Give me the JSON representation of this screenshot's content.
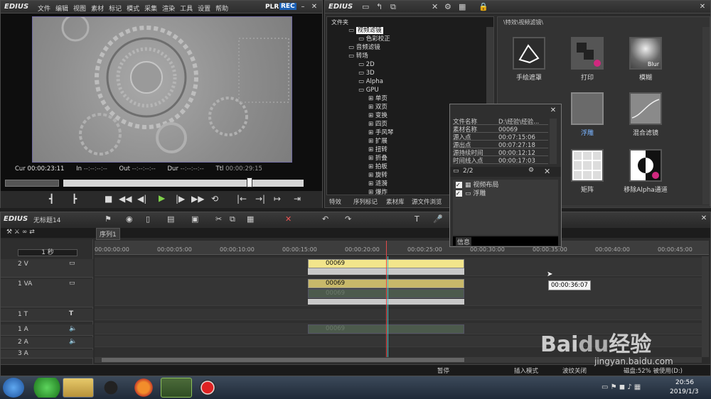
{
  "player": {
    "logo": "EDIUS",
    "menu": [
      "文件",
      "编辑",
      "视图",
      "素材",
      "标记",
      "模式",
      "采集",
      "渲染",
      "工具",
      "设置",
      "帮助"
    ],
    "plr": "PLR",
    "rec": "REC",
    "cur_label": "Cur",
    "cur": "00:00:23:11",
    "in_label": "In",
    "in": "--:--:--:--",
    "out_label": "Out",
    "out": "--:--:--:--",
    "dur_label": "Dur",
    "dur": "--:--:--:--",
    "ttl_label": "Ttl",
    "ttl": "00:00:29:15"
  },
  "effects": {
    "logo": "EDIUS",
    "folder_label": "文件夹",
    "path": "\\特效\\视频滤镜\\",
    "tree": [
      {
        "label": "视频滤镜",
        "level": 1,
        "selected": true
      },
      {
        "label": "色彩校正",
        "level": 2
      },
      {
        "label": "音频滤镜",
        "level": 1
      },
      {
        "label": "转场",
        "level": 1
      },
      {
        "label": "2D",
        "level": 2
      },
      {
        "label": "3D",
        "level": 2
      },
      {
        "label": "Alpha",
        "level": 2
      },
      {
        "label": "GPU",
        "level": 2
      },
      {
        "label": "单页",
        "level": 3
      },
      {
        "label": "双页",
        "level": 3
      },
      {
        "label": "变换",
        "level": 3
      },
      {
        "label": "四页",
        "level": 3
      },
      {
        "label": "手风琴",
        "level": 3
      },
      {
        "label": "扩展",
        "level": 3
      },
      {
        "label": "扭转",
        "level": 3
      },
      {
        "label": "折叠",
        "level": 3
      },
      {
        "label": "拍板",
        "level": 3
      },
      {
        "label": "旋转",
        "level": 3
      },
      {
        "label": "涟漪",
        "level": 3
      },
      {
        "label": "爆炸",
        "level": 3
      }
    ],
    "tabs": [
      "特效",
      "序列标记",
      "素材库",
      "源文件浏览"
    ],
    "items": [
      {
        "label": "手绘遮罩"
      },
      {
        "label": "打印"
      },
      {
        "label": "模糊",
        "badge": "Blur"
      },
      {
        "label": ""
      },
      {
        "label": "浮雕"
      },
      {
        "label": "混合滤镜"
      },
      {
        "label": ""
      },
      {
        "label": "矩阵"
      },
      {
        "label": "移除Alpha通道"
      }
    ]
  },
  "info": {
    "rows": [
      [
        "文件名称",
        "D:\\经验\\经验..."
      ],
      [
        "素材名称",
        "00069"
      ],
      [
        "源入点",
        "00:07:15:06"
      ],
      [
        "源出点",
        "00:07:27:18"
      ],
      [
        "源持续时间",
        "00:00:12:12"
      ],
      [
        "时间线入点",
        "00:00:17:03"
      ]
    ],
    "count": "2/2",
    "filters": [
      "视频布局",
      "浮雕"
    ],
    "footer": "信息"
  },
  "timeline": {
    "logo": "EDIUS",
    "project": "无标题14",
    "sequence_tab": "序列1",
    "scale": "1 秒",
    "ruler": [
      "00:00:00:00",
      "00:00:05:00",
      "00:00:10:00",
      "00:00:15:00",
      "00:00:20:00",
      "00:00:25:00",
      "00:00:30:00",
      "00:00:35:00",
      "00:00:40:00",
      "00:00:45:00"
    ],
    "tracks": [
      "2 V",
      "1 VA",
      "1 T",
      "1 A",
      "2 A",
      "3 A"
    ],
    "clip_name": "00069",
    "tooltip": "00:00:36:07",
    "status": {
      "pause": "暂停",
      "mode": "插入模式",
      "ripple": "波纹关闭",
      "disk": "磁盘:52% 被使用(D:)"
    }
  },
  "taskbar": {
    "time": "20:56",
    "date": "2019/1/3"
  },
  "watermark": {
    "site": "jingyan.baidu.com"
  }
}
